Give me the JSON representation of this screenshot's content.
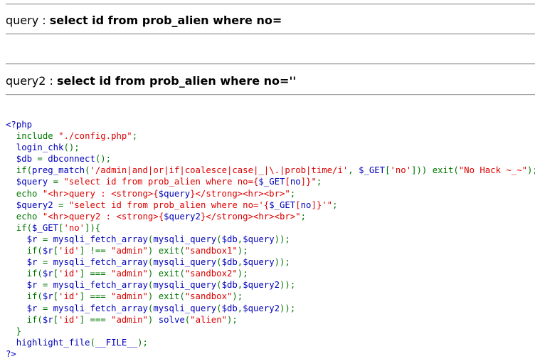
{
  "query1": {
    "prefix": "query : ",
    "sql": "select id from prob_alien where no="
  },
  "query2": {
    "prefix": "query2 : ",
    "sql": "select id from prob_alien where no=''"
  },
  "source": {
    "lines": [
      [
        {
          "c": "blue",
          "t": "<?php"
        }
      ],
      [
        {
          "c": "green",
          "t": "  include "
        },
        {
          "c": "red",
          "t": "\"./config.php\""
        },
        {
          "c": "green",
          "t": ";"
        }
      ],
      [
        {
          "c": "blue",
          "t": "  login_chk"
        },
        {
          "c": "green",
          "t": "();"
        }
      ],
      [
        {
          "c": "blue",
          "t": "  $db "
        },
        {
          "c": "green",
          "t": "= "
        },
        {
          "c": "blue",
          "t": "dbconnect"
        },
        {
          "c": "green",
          "t": "();"
        }
      ],
      [
        {
          "c": "green",
          "t": "  if("
        },
        {
          "c": "blue",
          "t": "preg_match"
        },
        {
          "c": "green",
          "t": "("
        },
        {
          "c": "red",
          "t": "'/admin|and|or|if|coalesce|case|_|\\.|prob|time/i'"
        },
        {
          "c": "green",
          "t": ", "
        },
        {
          "c": "blue",
          "t": "$_GET"
        },
        {
          "c": "green",
          "t": "["
        },
        {
          "c": "red",
          "t": "'no'"
        },
        {
          "c": "green",
          "t": "])) exit("
        },
        {
          "c": "red",
          "t": "\"No Hack ~_~\""
        },
        {
          "c": "green",
          "t": ");"
        }
      ],
      [
        {
          "c": "blue",
          "t": "  $query "
        },
        {
          "c": "green",
          "t": "= "
        },
        {
          "c": "red",
          "t": "\"select id from prob_alien where no={"
        },
        {
          "c": "blue",
          "t": "$_GET"
        },
        {
          "c": "red",
          "t": "["
        },
        {
          "c": "blue",
          "t": "no"
        },
        {
          "c": "red",
          "t": "]}\""
        },
        {
          "c": "green",
          "t": ";"
        }
      ],
      [
        {
          "c": "green",
          "t": "  echo "
        },
        {
          "c": "red",
          "t": "\"<hr>query : <strong>{"
        },
        {
          "c": "blue",
          "t": "$query"
        },
        {
          "c": "red",
          "t": "}</strong><hr><br>\""
        },
        {
          "c": "green",
          "t": ";"
        }
      ],
      [
        {
          "c": "blue",
          "t": "  $query2 "
        },
        {
          "c": "green",
          "t": "= "
        },
        {
          "c": "red",
          "t": "\"select id from prob_alien where no='{"
        },
        {
          "c": "blue",
          "t": "$_GET"
        },
        {
          "c": "red",
          "t": "["
        },
        {
          "c": "blue",
          "t": "no"
        },
        {
          "c": "red",
          "t": "]}'\""
        },
        {
          "c": "green",
          "t": ";"
        }
      ],
      [
        {
          "c": "green",
          "t": "  echo "
        },
        {
          "c": "red",
          "t": "\"<hr>query2 : <strong>{"
        },
        {
          "c": "blue",
          "t": "$query2"
        },
        {
          "c": "red",
          "t": "}</strong><hr><br>\""
        },
        {
          "c": "green",
          "t": ";"
        }
      ],
      [
        {
          "c": "green",
          "t": "  if("
        },
        {
          "c": "blue",
          "t": "$_GET"
        },
        {
          "c": "green",
          "t": "["
        },
        {
          "c": "red",
          "t": "'no'"
        },
        {
          "c": "green",
          "t": "]){"
        }
      ],
      [
        {
          "c": "blue",
          "t": "    $r "
        },
        {
          "c": "green",
          "t": "= "
        },
        {
          "c": "blue",
          "t": "mysqli_fetch_array"
        },
        {
          "c": "green",
          "t": "("
        },
        {
          "c": "blue",
          "t": "mysqli_query"
        },
        {
          "c": "green",
          "t": "("
        },
        {
          "c": "blue",
          "t": "$db"
        },
        {
          "c": "green",
          "t": ","
        },
        {
          "c": "blue",
          "t": "$query"
        },
        {
          "c": "green",
          "t": "));"
        }
      ],
      [
        {
          "c": "green",
          "t": "    if("
        },
        {
          "c": "blue",
          "t": "$r"
        },
        {
          "c": "green",
          "t": "["
        },
        {
          "c": "red",
          "t": "'id'"
        },
        {
          "c": "green",
          "t": "] !== "
        },
        {
          "c": "red",
          "t": "\"admin\""
        },
        {
          "c": "green",
          "t": ") exit("
        },
        {
          "c": "red",
          "t": "\"sandbox1\""
        },
        {
          "c": "green",
          "t": ");"
        }
      ],
      [
        {
          "c": "blue",
          "t": "    $r "
        },
        {
          "c": "green",
          "t": "= "
        },
        {
          "c": "blue",
          "t": "mysqli_fetch_array"
        },
        {
          "c": "green",
          "t": "("
        },
        {
          "c": "blue",
          "t": "mysqli_query"
        },
        {
          "c": "green",
          "t": "("
        },
        {
          "c": "blue",
          "t": "$db"
        },
        {
          "c": "green",
          "t": ","
        },
        {
          "c": "blue",
          "t": "$query"
        },
        {
          "c": "green",
          "t": "));"
        }
      ],
      [
        {
          "c": "green",
          "t": "    if("
        },
        {
          "c": "blue",
          "t": "$r"
        },
        {
          "c": "green",
          "t": "["
        },
        {
          "c": "red",
          "t": "'id'"
        },
        {
          "c": "green",
          "t": "] === "
        },
        {
          "c": "red",
          "t": "\"admin\""
        },
        {
          "c": "green",
          "t": ") exit("
        },
        {
          "c": "red",
          "t": "\"sandbox2\""
        },
        {
          "c": "green",
          "t": ");"
        }
      ],
      [
        {
          "c": "blue",
          "t": "    $r "
        },
        {
          "c": "green",
          "t": "= "
        },
        {
          "c": "blue",
          "t": "mysqli_fetch_array"
        },
        {
          "c": "green",
          "t": "("
        },
        {
          "c": "blue",
          "t": "mysqli_query"
        },
        {
          "c": "green",
          "t": "("
        },
        {
          "c": "blue",
          "t": "$db"
        },
        {
          "c": "green",
          "t": ","
        },
        {
          "c": "blue",
          "t": "$query2"
        },
        {
          "c": "green",
          "t": "));"
        }
      ],
      [
        {
          "c": "green",
          "t": "    if("
        },
        {
          "c": "blue",
          "t": "$r"
        },
        {
          "c": "green",
          "t": "["
        },
        {
          "c": "red",
          "t": "'id'"
        },
        {
          "c": "green",
          "t": "] === "
        },
        {
          "c": "red",
          "t": "\"admin\""
        },
        {
          "c": "green",
          "t": ") exit("
        },
        {
          "c": "red",
          "t": "\"sandbox\""
        },
        {
          "c": "green",
          "t": ");"
        }
      ],
      [
        {
          "c": "blue",
          "t": "    $r "
        },
        {
          "c": "green",
          "t": "= "
        },
        {
          "c": "blue",
          "t": "mysqli_fetch_array"
        },
        {
          "c": "green",
          "t": "("
        },
        {
          "c": "blue",
          "t": "mysqli_query"
        },
        {
          "c": "green",
          "t": "("
        },
        {
          "c": "blue",
          "t": "$db"
        },
        {
          "c": "green",
          "t": ","
        },
        {
          "c": "blue",
          "t": "$query2"
        },
        {
          "c": "green",
          "t": "));"
        }
      ],
      [
        {
          "c": "green",
          "t": "    if("
        },
        {
          "c": "blue",
          "t": "$r"
        },
        {
          "c": "green",
          "t": "["
        },
        {
          "c": "red",
          "t": "'id'"
        },
        {
          "c": "green",
          "t": "] === "
        },
        {
          "c": "red",
          "t": "\"admin\""
        },
        {
          "c": "green",
          "t": ") "
        },
        {
          "c": "blue",
          "t": "solve"
        },
        {
          "c": "green",
          "t": "("
        },
        {
          "c": "red",
          "t": "\"alien\""
        },
        {
          "c": "green",
          "t": ");"
        }
      ],
      [
        {
          "c": "green",
          "t": "  }"
        }
      ],
      [
        {
          "c": "blue",
          "t": "  highlight_file"
        },
        {
          "c": "green",
          "t": "("
        },
        {
          "c": "blue",
          "t": "__FILE__"
        },
        {
          "c": "green",
          "t": ");"
        }
      ],
      [
        {
          "c": "blue",
          "t": "?>"
        }
      ]
    ]
  }
}
